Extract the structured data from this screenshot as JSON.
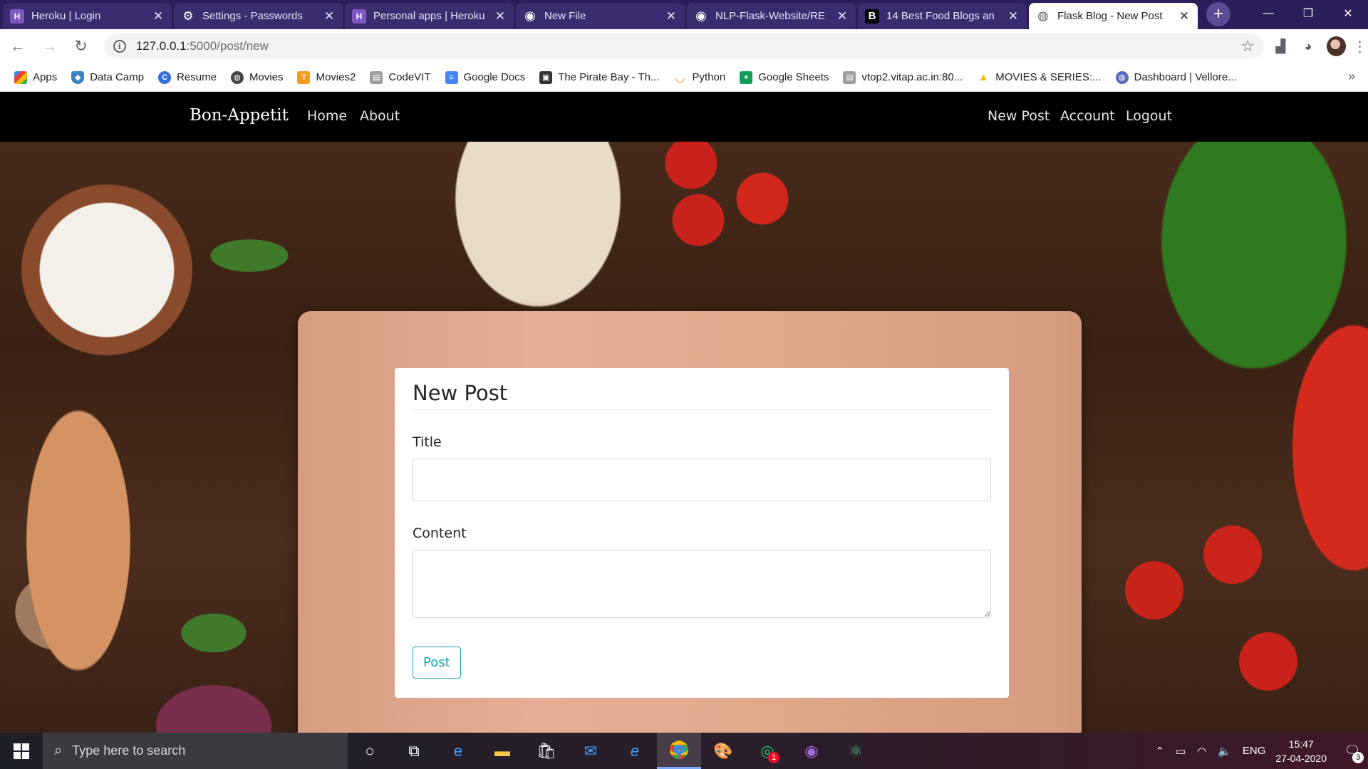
{
  "browser": {
    "tabs": [
      {
        "title": "Heroku | Login",
        "icon": "heroku-icon",
        "color": "#7e57c2",
        "glyph": "H"
      },
      {
        "title": "Settings - Passwords",
        "icon": "gear-icon",
        "color": "#3a2c6e",
        "glyph": "⚙"
      },
      {
        "title": "Personal apps | Heroku",
        "icon": "heroku-icon",
        "color": "#7e57c2",
        "glyph": "H"
      },
      {
        "title": "New File",
        "icon": "github-icon",
        "color": "#3a2c6e",
        "glyph": "◉"
      },
      {
        "title": "NLP-Flask-Website/RE",
        "icon": "github-icon",
        "color": "#3a2c6e",
        "glyph": "◉"
      },
      {
        "title": "14 Best Food Blogs an",
        "icon": "b-icon",
        "color": "#000000",
        "glyph": "B"
      },
      {
        "title": "Flask Blog - New Post",
        "icon": "globe-icon",
        "color": "#9aa0a6",
        "glyph": "◍"
      }
    ],
    "active_tab_index": 6,
    "url_host": "127.0.0.1",
    "url_path": ":5000/post/new",
    "bookmarks": [
      {
        "label": "Apps",
        "icon": "apps-grid-icon",
        "color": "#4285f4",
        "glyph": "⣿"
      },
      {
        "label": "Data Camp",
        "icon": "shield-icon",
        "color": "#3b82c4",
        "glyph": "◆"
      },
      {
        "label": "Resume",
        "icon": "c-icon",
        "color": "#2f6fd6",
        "glyph": "C"
      },
      {
        "label": "Movies",
        "icon": "globe-icon",
        "color": "#444444",
        "glyph": "◍"
      },
      {
        "label": "Movies2",
        "icon": "t-icon",
        "color": "#f29b19",
        "glyph": "T"
      },
      {
        "label": "CodeVIT",
        "icon": "page-icon",
        "color": "#9e9e9e",
        "glyph": "▤"
      },
      {
        "label": "Google Docs",
        "icon": "docs-icon",
        "color": "#4285f4",
        "glyph": "≡"
      },
      {
        "label": "The Pirate Bay - Th...",
        "icon": "pirate-icon",
        "color": "#333333",
        "glyph": "▣"
      },
      {
        "label": "Python",
        "icon": "python-icon",
        "color": "#f0881a",
        "glyph": "◡"
      },
      {
        "label": "Google Sheets",
        "icon": "sheets-icon",
        "color": "#0f9d58",
        "glyph": "+"
      },
      {
        "label": "vtop2.vitap.ac.in:80...",
        "icon": "page-icon",
        "color": "#9e9e9e",
        "glyph": "▤"
      },
      {
        "label": "MOVIES & SERIES:...",
        "icon": "drive-icon",
        "color": "#fbbc04",
        "glyph": "▲"
      },
      {
        "label": "Dashboard | Vellore...",
        "icon": "globe-icon",
        "color": "#5c6bc0",
        "glyph": "◍"
      }
    ]
  },
  "site": {
    "brand": "Bon-Appetit",
    "nav_left": [
      "Home",
      "About"
    ],
    "nav_right": [
      "New Post",
      "Account",
      "Logout"
    ]
  },
  "form": {
    "heading": "New Post",
    "title_label": "Title",
    "title_value": "",
    "content_label": "Content",
    "content_value": "",
    "submit_label": "Post",
    "accent_color": "#17a2b8"
  },
  "taskbar": {
    "search_placeholder": "Type here to search",
    "apps": [
      "cortana-icon",
      "task-view-icon",
      "edge-icon",
      "file-explorer-icon",
      "store-icon",
      "mail-icon",
      "ie-icon",
      "chrome-icon",
      "paint-icon",
      "whatsapp-icon",
      "github-desktop-icon",
      "atom-icon"
    ],
    "whatsapp_badge": "1",
    "language": "ENG",
    "time": "15:47",
    "date": "27-04-2020",
    "notification_count": "3"
  }
}
